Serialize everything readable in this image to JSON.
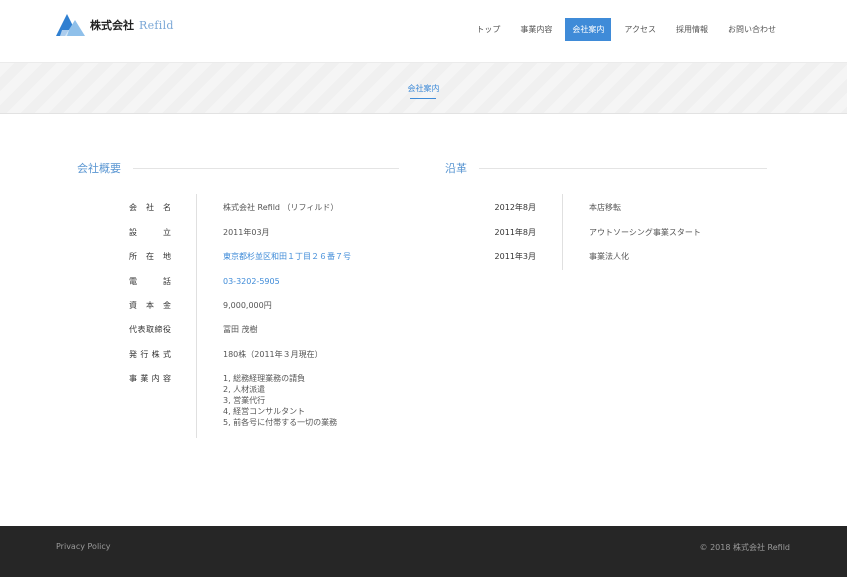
{
  "header": {
    "logo_jp": "株式会社",
    "logo_en": "Refild",
    "nav": [
      {
        "label": "トップ"
      },
      {
        "label": "事業内容"
      },
      {
        "label": "会社案内"
      },
      {
        "label": "アクセス"
      },
      {
        "label": "採用情報"
      },
      {
        "label": "お問い合わせ"
      }
    ],
    "active_nav": "会社案内"
  },
  "banner": {
    "title": "会社案内"
  },
  "overview": {
    "heading": "会社概要",
    "rows": [
      {
        "label": "会 社 名",
        "value": "株式会社 Refild （リフィルド）"
      },
      {
        "label": "設 立",
        "value": "2011年03月"
      },
      {
        "label": "所 在 地",
        "value": "東京都杉並区和田１丁目２６番７号"
      },
      {
        "label": "電 話",
        "value": "03-3202-5905"
      },
      {
        "label": "資 本 金",
        "value": "9,000,000円"
      },
      {
        "label": "代表取締役",
        "value": "冨田 茂樹"
      },
      {
        "label": "発 行 株 式",
        "value": "180株（2011年３月現在）"
      },
      {
        "label": "事 業 内 容",
        "lines": [
          "1, 総務経理業務の請負",
          "2, 人材派遣",
          "3, 営業代行",
          "4, 経営コンサルタント",
          "5, 前各号に付帯する一切の業務"
        ]
      }
    ]
  },
  "history": {
    "heading": "沿革",
    "rows": [
      {
        "date": "2012年8月",
        "text": "本店移転"
      },
      {
        "date": "2011年8月",
        "text": "アウトソーシング事業スタート"
      },
      {
        "date": "2011年3月",
        "text": "事業法人化"
      }
    ]
  },
  "footer": {
    "privacy": "Privacy Policy",
    "copyright": "© 2018 株式会社 Refild"
  },
  "colors": {
    "accent": "#3f8bd8",
    "footer_bg": "#262626"
  }
}
